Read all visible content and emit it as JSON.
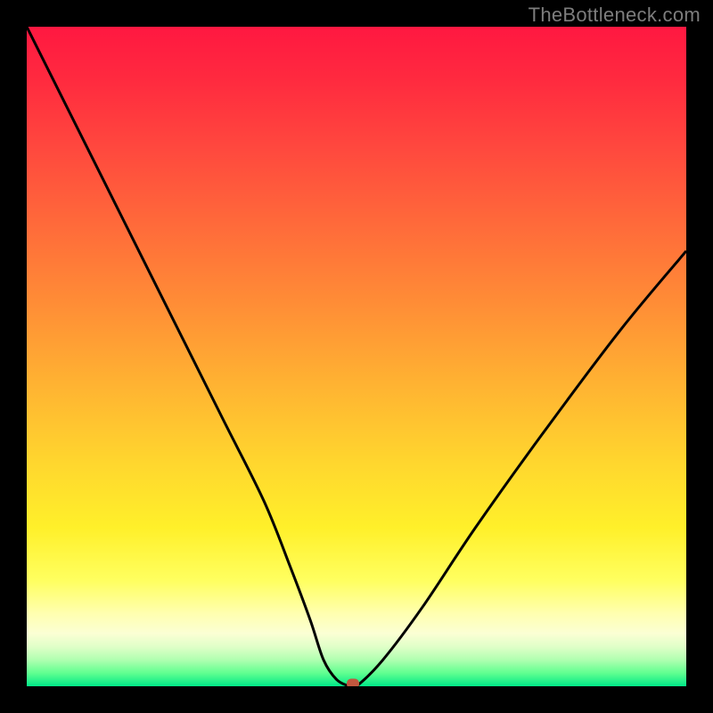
{
  "watermark": "TheBottleneck.com",
  "colors": {
    "frame_bg": "#000000",
    "curve_stroke": "#000000",
    "marker_fill": "#c1573e",
    "watermark_color": "#7d7d7d"
  },
  "chart_data": {
    "type": "line",
    "title": "",
    "xlabel": "",
    "ylabel": "",
    "xlim": [
      0,
      100
    ],
    "ylim": [
      0,
      100
    ],
    "x": [
      0,
      6,
      12,
      18,
      24,
      30,
      36,
      40,
      43,
      45,
      47,
      49,
      50,
      54,
      60,
      68,
      78,
      90,
      100
    ],
    "values": [
      100,
      88,
      76,
      64,
      52,
      40,
      28,
      18,
      10,
      4,
      1,
      0,
      0,
      4,
      12,
      24,
      38,
      54,
      66
    ],
    "marker": {
      "x": 49.5,
      "y": 0
    },
    "note": "V-shaped bottleneck curve. y is mismatch percentage (0 at bottom = optimal, 100 at top = worst). Minimum around x≈49. Values estimated from pixel positions; no axis tick labels are visible."
  }
}
